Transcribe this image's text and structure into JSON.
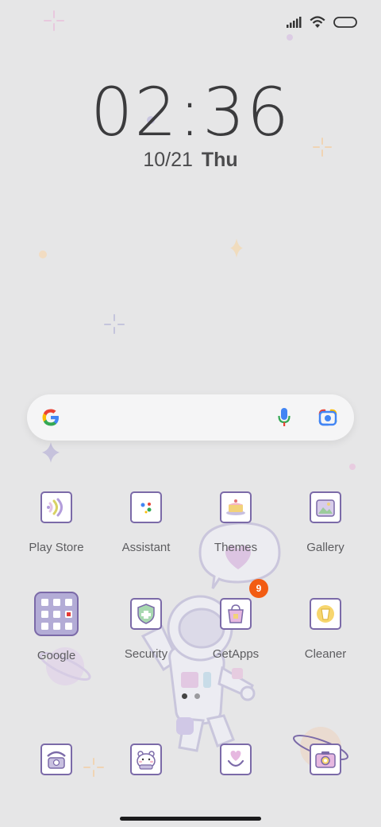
{
  "lockscreen": {
    "time": "02:36",
    "date": "10/21",
    "day": "Thu"
  },
  "status_bar": {
    "icons": [
      "signal-icon",
      "wifi-icon",
      "battery-icon"
    ]
  },
  "search_widget": {
    "logo": "google-g-icon",
    "voice_icon": "microphone-icon",
    "lens_icon": "camera-lens-icon"
  },
  "apps": {
    "row1": [
      {
        "label": "Play Store",
        "icon": "play-store-icon"
      },
      {
        "label": "Assistant",
        "icon": "assistant-icon"
      },
      {
        "label": "Themes",
        "icon": "themes-icon"
      },
      {
        "label": "Gallery",
        "icon": "gallery-icon"
      }
    ],
    "row2": [
      {
        "label": "Google",
        "icon": "google-folder-icon"
      },
      {
        "label": "Security",
        "icon": "security-icon"
      },
      {
        "label": "GetApps",
        "icon": "getapps-icon",
        "badge": "9"
      },
      {
        "label": "Cleaner",
        "icon": "cleaner-icon"
      }
    ],
    "dock": [
      {
        "icon": "phone-icon"
      },
      {
        "icon": "messages-icon"
      },
      {
        "icon": "browser-icon"
      },
      {
        "icon": "camera-icon"
      }
    ]
  },
  "colors": {
    "background": "#e6e6e7",
    "icon_outline": "#7b6aa8",
    "badge": "#f25c13"
  }
}
